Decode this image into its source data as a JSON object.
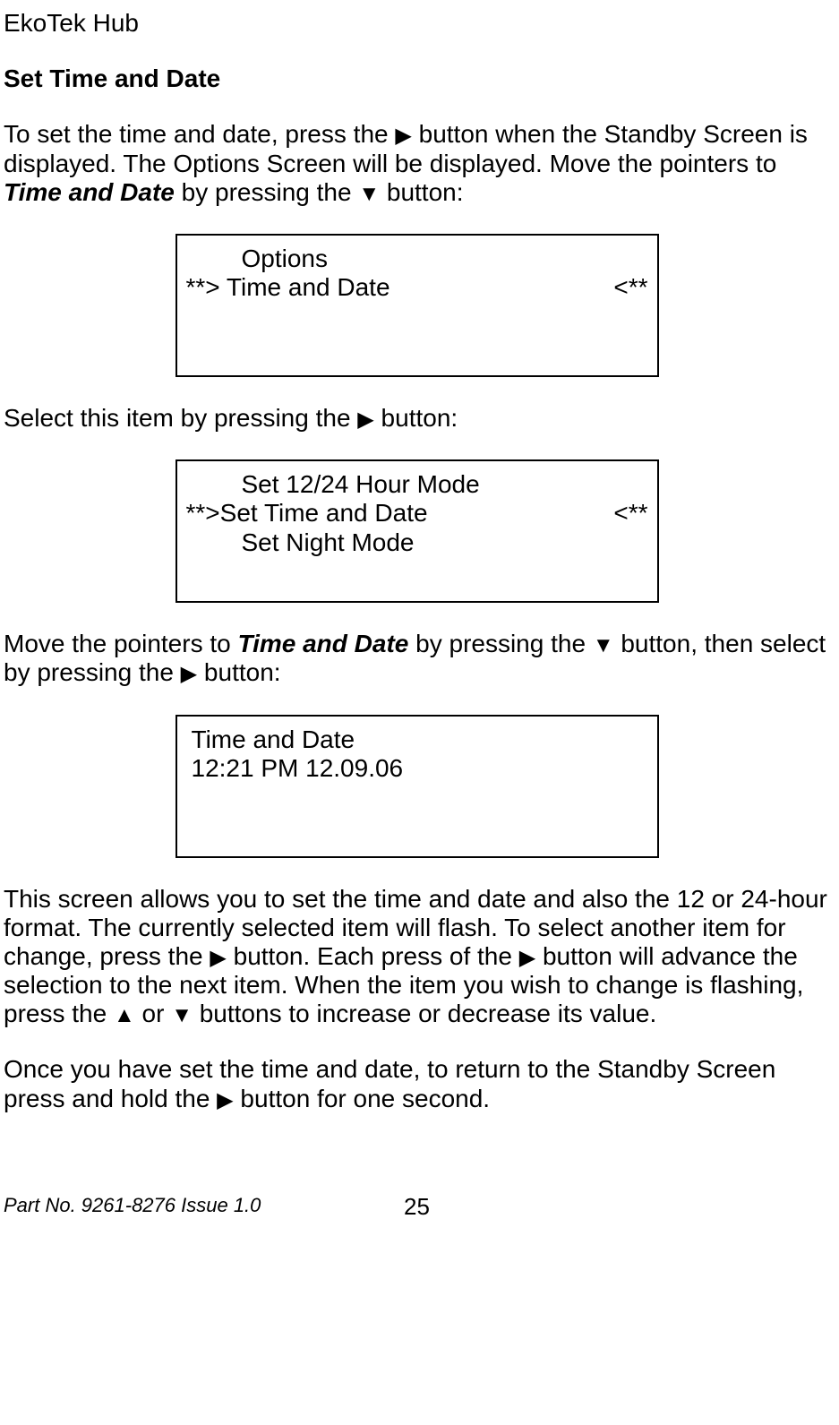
{
  "header": {
    "title": "EkoTek Hub"
  },
  "section": {
    "heading": "Set Time and Date"
  },
  "triangles": {
    "right": "▶",
    "down": "▼",
    "up": "▲"
  },
  "para1": {
    "t1": "To set the time and date, press the ",
    "t2": " button when the Standby Screen is displayed.  The Options Screen will be displayed.  Move the pointers to ",
    "bold1": "Time and Date",
    "t3": " by pressing the ",
    "t4": " button:"
  },
  "screen1": {
    "line1": "Options",
    "line2_left": "**> Time and Date",
    "line2_right": "<**"
  },
  "para2": {
    "t1": "Select this item by pressing the ",
    "t2": " button:"
  },
  "screen2": {
    "line1": "Set 12/24 Hour Mode",
    "line2_left": "**>Set Time and Date",
    "line2_right": "<**",
    "line3": "Set Night Mode"
  },
  "para3": {
    "t1": "Move the pointers to ",
    "bold1": "Time and Date",
    "t2": " by pressing the ",
    "t3": " button, then select by pressing the ",
    "t4": " button:"
  },
  "screen3": {
    "line1": "Time and Date",
    "line2": "12:21 PM 12.09.06"
  },
  "para4": {
    "t1": "This screen allows you to set the time and date and also the 12 or 24-hour format.  The currently selected item will flash.  To select another item for change, press the ",
    "t2": " button.  Each press of the ",
    "t3": " button will advance the selection to the next item.  When the item you wish to change is flashing, press the ",
    "t4": " or ",
    "t5": " buttons to increase or decrease its value."
  },
  "para5": {
    "t1": "Once you have set the time and date, to return to the Standby Screen press and hold the ",
    "t2": " button for one second."
  },
  "footer": {
    "left": "Part No. 9261-8276  Issue 1.0",
    "center": "25"
  }
}
